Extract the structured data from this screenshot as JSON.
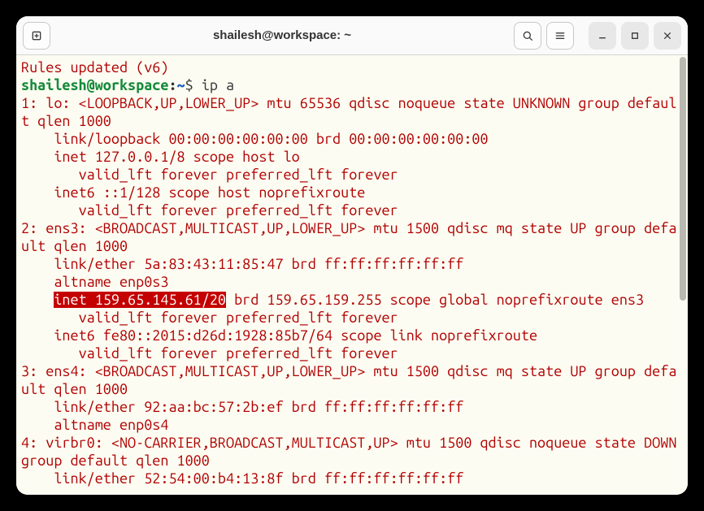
{
  "title": "shailesh@workspace: ~",
  "prompt": {
    "userhost": "shailesh@workspace",
    "colon": ":",
    "path": "~",
    "dollar": "$ ",
    "cmd": "ip a"
  },
  "rules_line": "Rules updated (v6)",
  "out": {
    "l1a": "1: lo: <LOOPBACK,UP,LOWER_UP> mtu 65536 qdisc noqueue state UNKNOWN group default qlen 1000",
    "l1b": "    link/loopback 00:00:00:00:00:00 brd 00:00:00:00:00:00",
    "l1c": "    inet 127.0.0.1/8 scope host lo",
    "l1d": "       valid_lft forever preferred_lft forever",
    "l1e": "    inet6 ::1/128 scope host noprefixroute",
    "l1f": "       valid_lft forever preferred_lft forever",
    "l2a": "2: ens3: <BROADCAST,MULTICAST,UP,LOWER_UP> mtu 1500 qdisc mq state UP group default qlen 1000",
    "l2b": "    link/ether 5a:83:43:11:85:47 brd ff:ff:ff:ff:ff:ff",
    "l2c": "    altname enp0s3",
    "l2d_pre": "    ",
    "l2d_hl": "inet 159.65.145.61/20",
    "l2d_post": " brd 159.65.159.255 scope global noprefixroute ens3",
    "l2e": "       valid_lft forever preferred_lft forever",
    "l2f": "    inet6 fe80::2015:d26d:1928:85b7/64 scope link noprefixroute",
    "l2g": "       valid_lft forever preferred_lft forever",
    "l3a": "3: ens4: <BROADCAST,MULTICAST,UP,LOWER_UP> mtu 1500 qdisc mq state UP group default qlen 1000",
    "l3b": "    link/ether 92:aa:bc:57:2b:ef brd ff:ff:ff:ff:ff:ff",
    "l3c": "    altname enp0s4",
    "l4a": "4: virbr0: <NO-CARRIER,BROADCAST,MULTICAST,UP> mtu 1500 qdisc noqueue state DOWN group default qlen 1000",
    "l4b": "    link/ether 52:54:00:b4:13:8f brd ff:ff:ff:ff:ff:ff"
  }
}
